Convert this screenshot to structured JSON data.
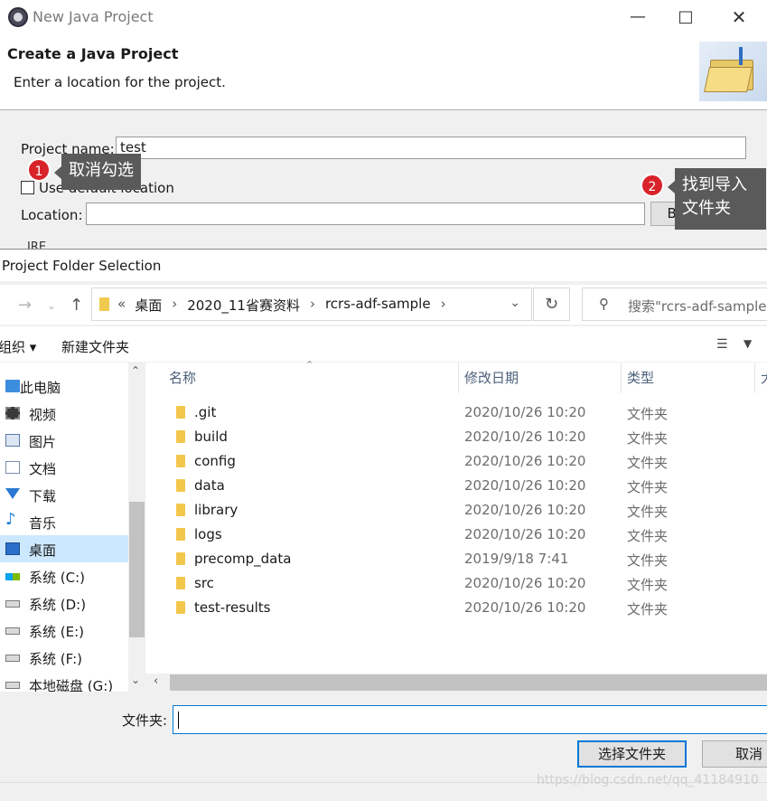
{
  "wizard": {
    "title": "New Java Project",
    "heading": "Create a Java Project",
    "subheading": "Enter a location for the project.",
    "project_name_label": "Project name:",
    "project_name_value": "test",
    "use_default_label": "Use default location",
    "use_default_checked": false,
    "location_label": "Location:",
    "location_value": "",
    "browse_label": "Browse...",
    "jre_label": "JRE"
  },
  "callouts": [
    {
      "number": "1",
      "text": "取消勾选"
    },
    {
      "number": "2",
      "text": "找到导入\n文件夹"
    }
  ],
  "dialog": {
    "title": "Project Folder Selection",
    "breadcrumbs": [
      "桌面",
      "2020_11省赛资料",
      "rcrs-adf-sample"
    ],
    "breadcrumb_prefix": "«",
    "search_placeholder": "搜索\"rcrs-adf-sample\"",
    "organize_label": "组织 ▾",
    "new_folder_label": "新建文件夹",
    "columns": [
      "名称",
      "修改日期",
      "类型",
      "大"
    ],
    "nav_items": [
      {
        "label": "此电脑",
        "icon": "computer-icon",
        "selected": false
      },
      {
        "label": "视频",
        "icon": "video-icon",
        "selected": false
      },
      {
        "label": "图片",
        "icon": "pictures-icon",
        "selected": false
      },
      {
        "label": "文档",
        "icon": "documents-icon",
        "selected": false
      },
      {
        "label": "下载",
        "icon": "download-icon",
        "selected": false
      },
      {
        "label": "音乐",
        "icon": "music-icon",
        "selected": false
      },
      {
        "label": "桌面",
        "icon": "desktop-icon",
        "selected": true
      },
      {
        "label": "系统 (C:)",
        "icon": "windows-drive-icon",
        "selected": false
      },
      {
        "label": "系统 (D:)",
        "icon": "drive-icon",
        "selected": false
      },
      {
        "label": "系统 (E:)",
        "icon": "drive-icon",
        "selected": false
      },
      {
        "label": "系统 (F:)",
        "icon": "drive-icon",
        "selected": false
      },
      {
        "label": "本地磁盘 (G:)",
        "icon": "drive-icon",
        "selected": false
      }
    ],
    "files": [
      {
        "name": ".git",
        "date": "2020/10/26 10:20",
        "type": "文件夹"
      },
      {
        "name": "build",
        "date": "2020/10/26 10:20",
        "type": "文件夹"
      },
      {
        "name": "config",
        "date": "2020/10/26 10:20",
        "type": "文件夹"
      },
      {
        "name": "data",
        "date": "2020/10/26 10:20",
        "type": "文件夹"
      },
      {
        "name": "library",
        "date": "2020/10/26 10:20",
        "type": "文件夹"
      },
      {
        "name": "logs",
        "date": "2020/10/26 10:20",
        "type": "文件夹"
      },
      {
        "name": "precomp_data",
        "date": "2019/9/18 7:41",
        "type": "文件夹"
      },
      {
        "name": "src",
        "date": "2020/10/26 10:20",
        "type": "文件夹"
      },
      {
        "name": "test-results",
        "date": "2020/10/26 10:20",
        "type": "文件夹"
      }
    ],
    "folder_label": "文件夹:",
    "folder_value": "",
    "select_button": "选择文件夹",
    "cancel_button": "取消"
  },
  "watermark": "https://blog.csdn.net/qq_41184910",
  "colors": {
    "accent": "#0078d7",
    "callout_badge": "#d8232a",
    "callout_bg": "#5a5a5a",
    "selected_nav": "#cce8ff"
  }
}
